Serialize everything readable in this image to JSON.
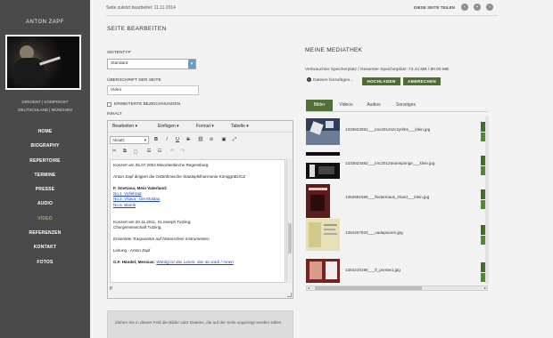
{
  "sidebar": {
    "name": "ANTON ZAPF",
    "subtitle_line1": "DIRIGENT | KOMPONIST",
    "subtitle_line2": "DEUTSCHLAND | MÜNCHEN",
    "nav": [
      {
        "label": "HOME",
        "active": false
      },
      {
        "label": "BIOGRAPHY",
        "active": false
      },
      {
        "label": "REPERTOIRE",
        "active": false
      },
      {
        "label": "TERMINE",
        "active": false
      },
      {
        "label": "PRESSE",
        "active": false
      },
      {
        "label": "AUDIO",
        "active": false
      },
      {
        "label": "VIDEO",
        "active": true
      },
      {
        "label": "REFERENZEN",
        "active": false
      },
      {
        "label": "KONTAKT",
        "active": false
      },
      {
        "label": "FOTOS",
        "active": false
      }
    ],
    "active_color": "#a9a57c"
  },
  "topbar": {
    "last_edited": "Seite zuletzt bearbeitet: 11.11.2014",
    "share": "DIESE SEITE TEILEN",
    "buttons": [
      {
        "icon": "chevron-left-icon",
        "glyph": "‹"
      },
      {
        "icon": "add-icon",
        "glyph": "+"
      },
      {
        "icon": "chevron-right-icon",
        "glyph": "›"
      }
    ]
  },
  "page_settings": {
    "heading": "SEITE BEARBEITEN",
    "seitentyp_label": "SEITENTYP",
    "seitentyp_value": "Standard",
    "ueberschrift_label": "ÜBERSCHRIFT DER SEITE",
    "ueberschrift_value": "Video",
    "extended_label": "ERWEITERTE BEZEICHNUNGEN",
    "inhalt_label": "INHALT"
  },
  "editor": {
    "menus": [
      "Bearbeiten",
      "Einfügen",
      "Format",
      "Tabelle"
    ],
    "format_select": "Absatz",
    "row2_buttons": [
      "B",
      "I",
      "U",
      "S",
      "⛓",
      "⊘",
      "▣",
      "⤢"
    ],
    "row3_buttons": [
      "✂",
      "⧉",
      "📋",
      "☰",
      "☷",
      "↶",
      "↷"
    ],
    "content": [
      {
        "t": "Konzert am 05.07.2004 Minoritenkirche Regensburg",
        "s": "n"
      },
      {
        "t": "",
        "s": "gap"
      },
      {
        "t": "Anton Zapf dirigiert die Ostböhmische Staatsphilharmonie Königgrätz/CZ",
        "s": "n"
      },
      {
        "t": "",
        "s": "gap"
      },
      {
        "t": "F. Smetana, Mein Vaterland:",
        "s": "b"
      },
      {
        "t": "No.1. Vyšehrad",
        "s": "a"
      },
      {
        "t": "No.2. Vltava - Die Moldau",
        "s": "a"
      },
      {
        "t": "No.6. Blaník",
        "s": "a"
      },
      {
        "t": "",
        "s": "gap"
      },
      {
        "t": "",
        "s": "gap"
      },
      {
        "t": "Konzert am 20.11.2011,  St.Joseph Tutzing:",
        "s": "n"
      },
      {
        "t": "Chorgemeinschaft Tutzing,",
        "s": "n"
      },
      {
        "t": "",
        "s": "gap"
      },
      {
        "t": "Ensemble Trasparente auf historischen Instrumenten",
        "s": "i"
      },
      {
        "t": "",
        "s": "gap"
      },
      {
        "t": "Leitung - Anton Zapf",
        "s": "n"
      },
      {
        "t": "",
        "s": "gap"
      },
      {
        "t": "G.F. Händel, Messias: ",
        "s": "b",
        "link": "Würdig ist das Lamm, das da starb / Amen"
      }
    ],
    "status": "P"
  },
  "dropzone": {
    "text": "Ziehen Sie in dieses Feld die Bilder oder Dateien, die auf der Seite angezeigt werden sollen"
  },
  "media": {
    "heading": "MEINE MEDIATHEK",
    "storage": "Verbrauchter Speicherplatz / Gesamter Speicherplatz: 73.42 MB / 80.00 MB",
    "add_files": "Dateien hinzufügen...",
    "btn_upload": "HOCHLADEN",
    "btn_cancel": "ABBRECHEN",
    "tabs": [
      "Bilder",
      "Videos",
      "Audios",
      "Sonstiges"
    ],
    "active_tab": 0,
    "accent": "#51703a",
    "files": [
      {
        "name": "1333623081___imc2012szczyrkhs___klein.jpg"
      },
      {
        "name": "1333623482___imc2012teamspringe___klein.jpg"
      },
      {
        "name": "1353581558___fledermaus_irland___klein.jpg"
      },
      {
        "name": "1354207933___uadapacem.jpg"
      },
      {
        "name": "1354210196___fl_presse1.jpg"
      }
    ]
  }
}
